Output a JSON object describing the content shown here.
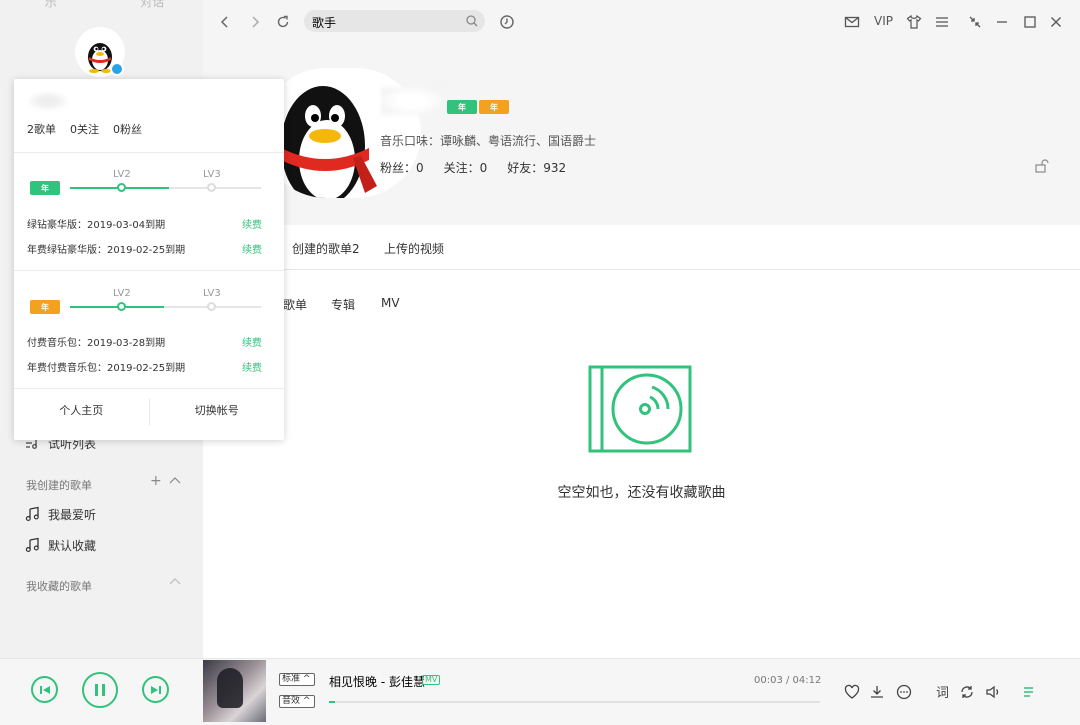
{
  "sidebar": {
    "top_tabs": [
      "乐",
      "对话"
    ],
    "menu_items": [
      {
        "label": "试听列表",
        "icon": "playlist-icon"
      }
    ],
    "created_section": {
      "label": "我创建的歌单"
    },
    "created_playlists": [
      {
        "label": "我最爱听",
        "icon": "music-note-icon"
      },
      {
        "label": "默认收藏",
        "icon": "music-note-icon"
      }
    ],
    "collected_section": {
      "label": "我收藏的歌单"
    }
  },
  "popup": {
    "counts": [
      "2歌单",
      "0关注",
      "0粉丝"
    ],
    "green_level": {
      "badge": "年",
      "from": "LV2",
      "to": "LV3",
      "progress": 0.52
    },
    "green_vips": [
      {
        "label": "绿钻豪华版：2019-03-04到期",
        "action": "续费"
      },
      {
        "label": "年费绿钻豪华版：2019-02-25到期",
        "action": "续费"
      }
    ],
    "music_level": {
      "badge": "年",
      "from": "LV2",
      "to": "LV3",
      "progress": 0.49
    },
    "music_vips": [
      {
        "label": "付费音乐包：2019-03-28到期",
        "action": "续费"
      },
      {
        "label": "年费付费音乐包：2019-02-25到期",
        "action": "续费"
      }
    ],
    "buttons": {
      "home": "个人主页",
      "switch": "切换帐号"
    }
  },
  "topbar": {
    "search_text": "歌手",
    "vip_label": "VIP"
  },
  "profile": {
    "badge_green": "年",
    "badge_orange": "年",
    "tagline": "音乐口味：谭咏麟、粤语流行、国语爵士",
    "stats": [
      "粉丝：0",
      "关注：0",
      "好友：932"
    ]
  },
  "tabs": {
    "main": [
      "创建的歌单2",
      "上传的视频"
    ],
    "sub": [
      "歌单",
      "专辑",
      "MV"
    ]
  },
  "empty_state": {
    "message": "空空如也，还没有收藏歌曲"
  },
  "player": {
    "quality_tag": "标准",
    "effect_tag": "音效",
    "song": "相见恨晚 - 彭佳慧",
    "mv_tag": "MV",
    "time": "00:03 / 04:12",
    "progress": 0.012,
    "lyric_btn": "词"
  },
  "colors": {
    "accent": "#31c27c",
    "lv_green": "#31c27c",
    "lv_orange": "#f4a11f"
  }
}
